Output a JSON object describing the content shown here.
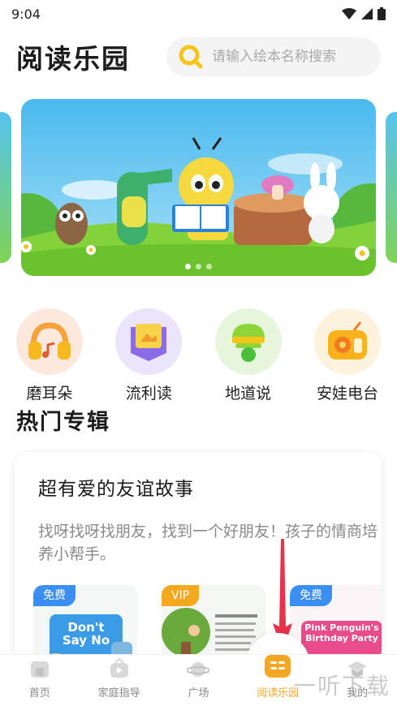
{
  "status_bar": {
    "time": "9:04"
  },
  "header": {
    "title": "阅读乐园"
  },
  "search": {
    "placeholder": "请输入绘本名称搜索"
  },
  "banner": {
    "active_index": 0,
    "dot_count": 3
  },
  "categories": [
    {
      "label": "磨耳朵",
      "icon": "headphones-icon",
      "bg": "#fde8de"
    },
    {
      "label": "流利读",
      "icon": "book-badge-icon",
      "bg": "#ebe4fb"
    },
    {
      "label": "地道说",
      "icon": "speech-cone-icon",
      "bg": "#e5f6dc"
    },
    {
      "label": "安娃电台",
      "icon": "radio-icon",
      "bg": "#fdf3dc"
    }
  ],
  "section": {
    "hot_albums_title": "热门专辑"
  },
  "album": {
    "title": "超有爱的友谊故事",
    "description": "找呀找呀找朋友，找到一个好朋友！孩子的情商培养小帮手。",
    "books": [
      {
        "tag": "免费",
        "tag_type": "free",
        "cover_text": "Don't Say No"
      },
      {
        "tag": "VIP",
        "tag_type": "vip",
        "cover_text": ""
      },
      {
        "tag": "免费",
        "tag_type": "free",
        "cover_text": "Pink Penguin's Birthday Party"
      }
    ]
  },
  "tabs": [
    {
      "label": "首页",
      "icon": "home-icon",
      "active": false
    },
    {
      "label": "家庭指导",
      "icon": "video-icon",
      "active": false
    },
    {
      "label": "广场",
      "icon": "planet-icon",
      "active": false
    },
    {
      "label": "阅读乐园",
      "icon": "reading-icon",
      "active": true
    },
    {
      "label": "我的",
      "icon": "graduation-cap-icon",
      "active": false
    }
  ],
  "colors": {
    "accent": "#f5a623",
    "free_tag": "#3b8ff2",
    "vip_tag": "#f4a81d"
  },
  "watermark": "一听下载"
}
